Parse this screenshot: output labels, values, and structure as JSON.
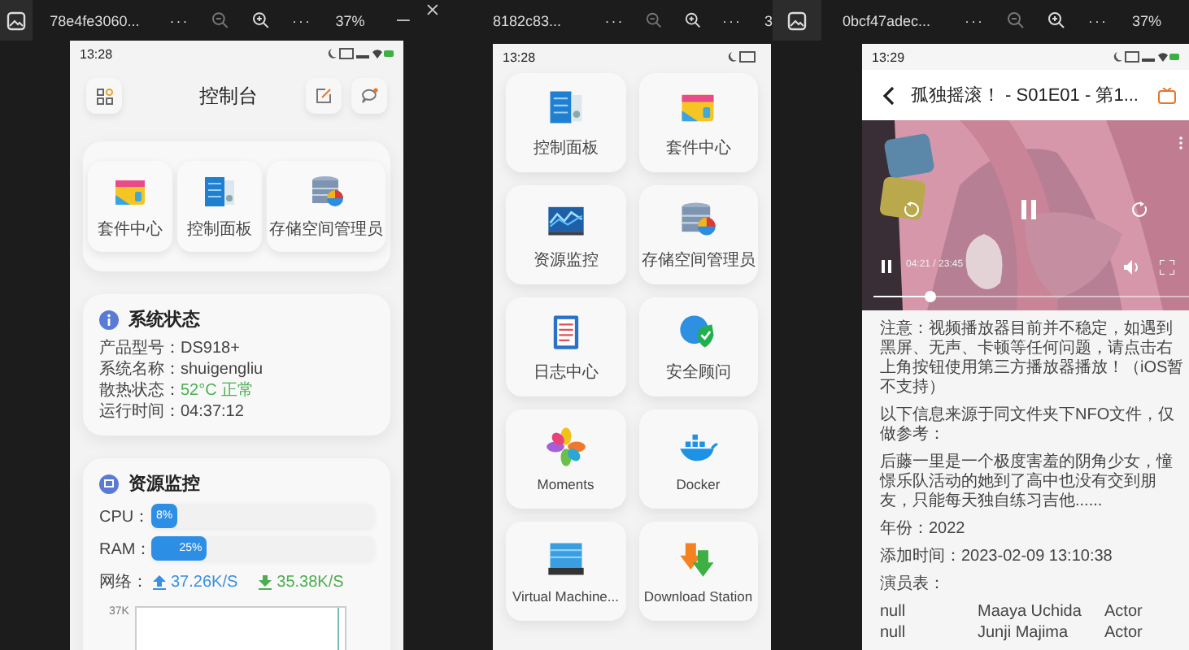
{
  "viewers": [
    {
      "title": "78e4fe3060...",
      "more": [
        "···",
        "···"
      ],
      "zoom": "37%"
    },
    {
      "title": "8182c83...",
      "more": [
        "···",
        "···"
      ],
      "zoom": "3"
    },
    {
      "title": "0bcf47adec...",
      "more": [
        "···",
        "···"
      ],
      "zoom": "37%"
    }
  ],
  "dashboard": {
    "status_time": "13:28",
    "title": "控制台",
    "apps": [
      {
        "label": "套件中心"
      },
      {
        "label": "控制面板"
      },
      {
        "label": "存储空间管理员"
      }
    ],
    "system_status": {
      "title": "系统状态",
      "rows": [
        {
          "label": "产品型号：",
          "value": "DS918+",
          "kind": "plain"
        },
        {
          "label": "系统名称：",
          "value": "shuigengliu",
          "kind": "plain"
        },
        {
          "label": "散热状态：",
          "value": "52°C 正常",
          "kind": "ok"
        },
        {
          "label": "运行时间：",
          "value": "04:37:12",
          "kind": "plain"
        }
      ]
    },
    "resources": {
      "title": "资源监控",
      "meters": [
        {
          "label": "CPU：",
          "level": 0.08,
          "reading": "8%"
        },
        {
          "label": "RAM：",
          "level": 0.25,
          "reading": "25%"
        }
      ],
      "network": {
        "label": "网络：",
        "upload": "37.26K/S",
        "download": "35.38K/S"
      },
      "chart_label": "37K"
    }
  },
  "app_grid": {
    "status_time": "13:28",
    "apps": [
      {
        "label": "控制面板"
      },
      {
        "label": "套件中心"
      },
      {
        "label": "资源监控"
      },
      {
        "label": "存储空间管理员"
      },
      {
        "label": "日志中心"
      },
      {
        "label": "安全顾问"
      },
      {
        "label": "Moments"
      },
      {
        "label": "Docker"
      },
      {
        "label": "Virtual Machine..."
      },
      {
        "label": "Download Station"
      }
    ]
  },
  "video_page": {
    "status_time": "13:29",
    "title": "孤独摇滚！ - S01E01 - 第1...",
    "player": {
      "time": "04:21 / 23:45",
      "level": 0.18
    },
    "paragraphs": [
      "注意：视频播放器目前并不稳定，如遇到黑屏、无声、卡顿等任何问题，请点击右上角按钮使用第三方播放器播放！（iOS暂不支持）",
      "以下信息来源于同文件夹下NFO文件，仅做参考：",
      "后藤一里是一个极度害羞的阴角少女，憧憬乐队活动的她到了高中也没有交到朋友，只能每天独自练习吉他......",
      "年份：2022",
      "添加时间：2023-02-09 13:10:38"
    ],
    "cast_title": "演员表：",
    "cast": [
      {
        "column_1": "null",
        "column_2": "Maaya Uchida",
        "column_3": "Actor"
      },
      {
        "column_1": "null",
        "column_2": "Junji Majima",
        "column_3": "Actor"
      }
    ]
  }
}
